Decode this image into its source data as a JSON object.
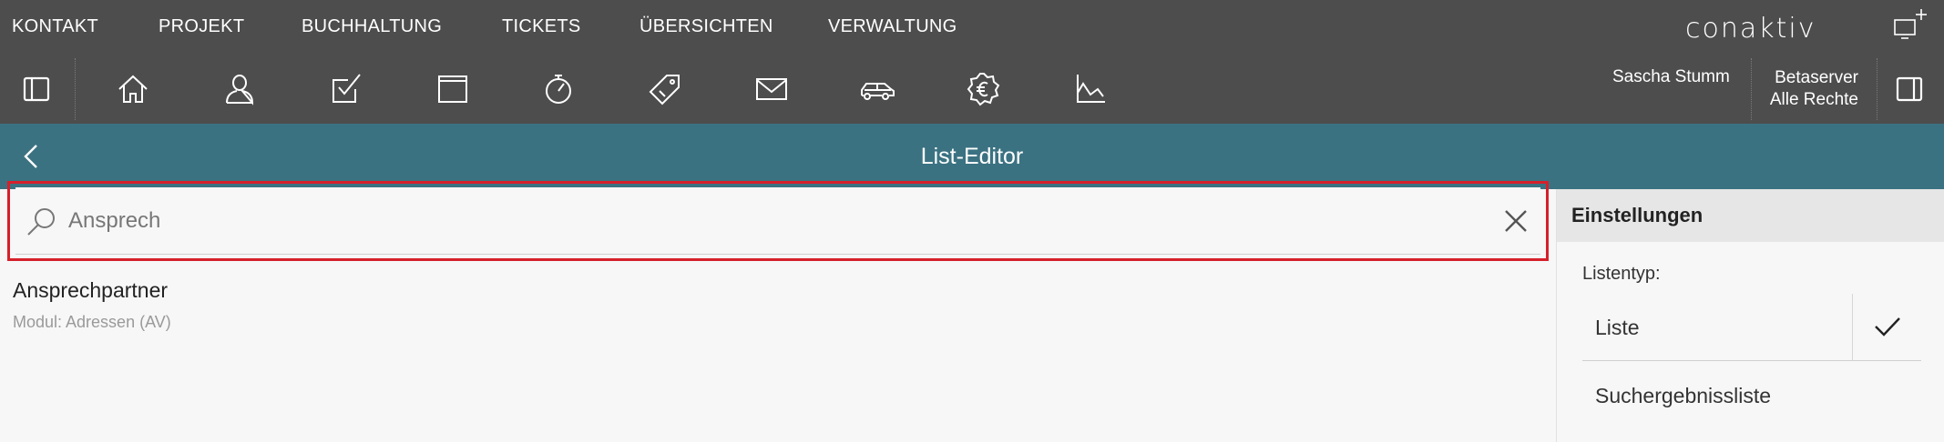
{
  "menu": {
    "items": [
      "KONTAKT",
      "PROJEKT",
      "BUCHHALTUNG",
      "TICKETS",
      "ÜBERSICHTEN",
      "VERWALTUNG"
    ],
    "logo": "conaktiv"
  },
  "toolbar": {
    "icons": [
      "sidebar-toggle-icon",
      "home-icon",
      "person-icon",
      "task-check-icon",
      "window-icon",
      "stopwatch-icon",
      "tag-icon",
      "mail-icon",
      "car-icon",
      "euro-badge-icon",
      "chart-icon"
    ],
    "user": "Sascha Stumm",
    "server_line1": "Betaserver",
    "server_line2": "Alle Rechte"
  },
  "header": {
    "title": "List-Editor"
  },
  "search": {
    "value": "",
    "placeholder": "Ansprech"
  },
  "results": [
    {
      "title": "Ansprechpartner",
      "subtitle": "Modul: Adressen (AV)"
    }
  ],
  "settings": {
    "header": "Einstellungen",
    "listtype_label": "Listentyp:",
    "options": [
      {
        "label": "Liste",
        "selected": true
      },
      {
        "label": "Suchergebnissliste",
        "selected": false
      }
    ]
  },
  "colors": {
    "toolbar_bg": "#4d4d4d",
    "titlebar_bg": "#3b7282",
    "highlight": "#d5202a"
  }
}
